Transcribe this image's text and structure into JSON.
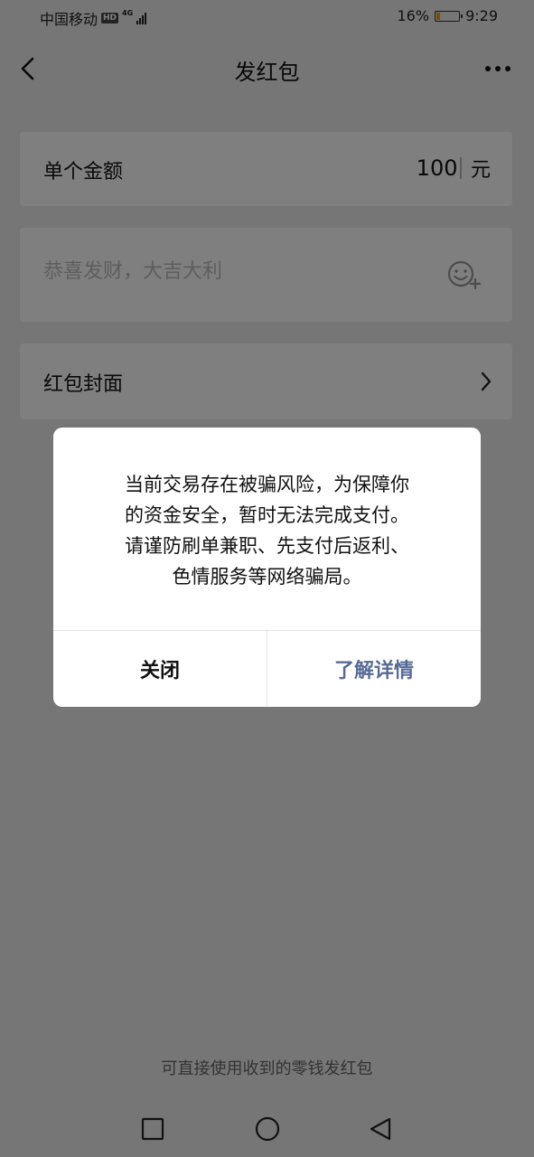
{
  "status_bar": {
    "carrier": "中国移动",
    "hd": "HD",
    "network": "4G",
    "battery_percent": "16%",
    "battery_level": 0.16,
    "time": "9:29"
  },
  "nav": {
    "title": "发红包",
    "back_icon": "chevron-left-icon",
    "more_icon": "more-dots-icon"
  },
  "form": {
    "amount_label": "单个金额",
    "amount_value": "100",
    "amount_unit": "元",
    "greeting_placeholder": "恭喜发财，大吉大利",
    "emoji_icon": "emoji-add-icon",
    "cover_label": "红包封面",
    "cover_icon": "chevron-right-icon"
  },
  "footer_hint": "可直接使用收到的零钱发红包",
  "dialog": {
    "message_lines": [
      "当前交易存在被骗风险，为保障你",
      "的资金安全，暂时无法完成支付。",
      "请谨防刷单兼职、先支付后返利、",
      "色情服务等网络骗局。"
    ],
    "close_label": "关闭",
    "details_label": "了解详情",
    "details_color": "#576b95"
  },
  "system_nav": {
    "recent_icon": "square-recent-icon",
    "home_icon": "circle-home-icon",
    "back_icon": "triangle-back-icon"
  }
}
